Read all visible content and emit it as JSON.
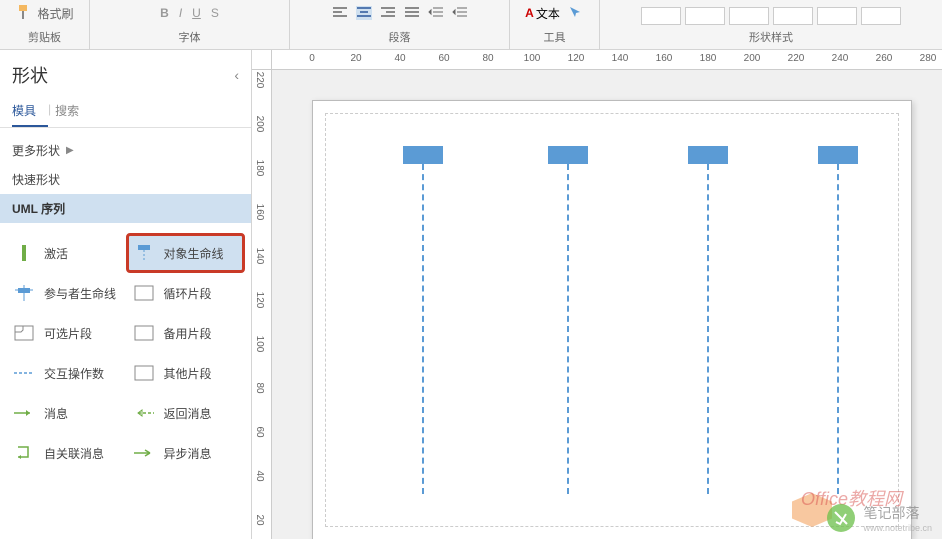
{
  "ribbon": {
    "clipboard": {
      "format_painter": "格式刷",
      "label": "剪贴板"
    },
    "font": {
      "label": "字体"
    },
    "paragraph": {
      "label": "段落"
    },
    "tools": {
      "text_label": "文本",
      "label": "工具"
    },
    "shape_styles": {
      "label": "形状样式"
    }
  },
  "sidebar": {
    "title": "形状",
    "tabs": {
      "stencils": "模具",
      "search": "搜索"
    },
    "stencils": {
      "more": "更多形状",
      "quick": "快速形状",
      "uml": "UML 序列"
    },
    "shapes": [
      {
        "label": "激活"
      },
      {
        "label": "对象生命线"
      },
      {
        "label": "参与者生命线"
      },
      {
        "label": "循环片段"
      },
      {
        "label": "可选片段"
      },
      {
        "label": "备用片段"
      },
      {
        "label": "交互操作数"
      },
      {
        "label": "其他片段"
      },
      {
        "label": "消息"
      },
      {
        "label": "返回消息"
      },
      {
        "label": "自关联消息"
      },
      {
        "label": "异步消息"
      }
    ]
  },
  "ruler": {
    "h": [
      "0",
      "20",
      "40",
      "60",
      "80",
      "100",
      "120",
      "140",
      "160",
      "180",
      "200",
      "220",
      "240",
      "260",
      "280"
    ],
    "v": [
      "220",
      "200",
      "180",
      "160",
      "140",
      "120",
      "100",
      "80",
      "60",
      "40",
      "20"
    ]
  },
  "canvas": {
    "lifeline_positions": [
      90,
      235,
      375,
      505
    ]
  },
  "watermark": {
    "office": "Office教程网",
    "name": "笔记部落",
    "url": "www.notetribe.cn"
  }
}
